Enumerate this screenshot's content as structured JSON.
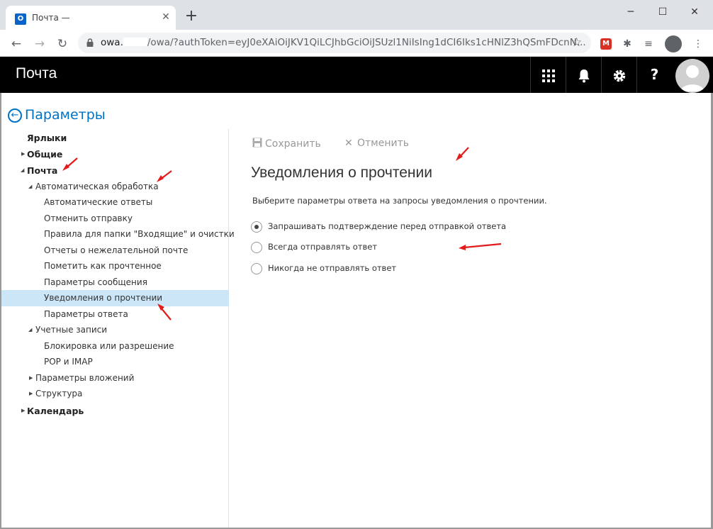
{
  "browser": {
    "tab_title": "Почта —",
    "tab_favicon_letter": "O",
    "url_host": "owa.",
    "url_rest": "/owa/?authToken=eyJ0eXAiOiJKV1QiLCJhbGciOiJSUzl1NiIsIng1dCI6Iks1cHNlZ3hQSmFDcnN..."
  },
  "appbar": {
    "title": "Почта",
    "help_glyph": "?"
  },
  "settings": {
    "back_label": "Параметры"
  },
  "sidebar": {
    "items": [
      {
        "label": "Ярлыки"
      },
      {
        "label": "Общие"
      },
      {
        "label": "Почта"
      },
      {
        "label": "Автоматическая обработка"
      },
      {
        "label": "Автоматические ответы"
      },
      {
        "label": "Отменить отправку"
      },
      {
        "label": "Правила для папки \"Входящие\" и очистки"
      },
      {
        "label": "Отчеты о нежелательной почте"
      },
      {
        "label": "Пометить как прочтенное"
      },
      {
        "label": "Параметры сообщения"
      },
      {
        "label": "Уведомления о прочтении"
      },
      {
        "label": "Параметры ответа"
      },
      {
        "label": "Учетные записи"
      },
      {
        "label": "Блокировка или разрешение"
      },
      {
        "label": "POP и IMAP"
      },
      {
        "label": "Параметры вложений"
      },
      {
        "label": "Структура"
      },
      {
        "label": "Календарь"
      }
    ]
  },
  "content": {
    "save_label": "Сохранить",
    "cancel_label": "Отменить",
    "heading": "Уведомления о прочтении",
    "description": "Выберите параметры ответа на запросы уведомления о прочтении.",
    "options": [
      {
        "label": "Запрашивать подтверждение перед отправкой ответа",
        "checked": true
      },
      {
        "label": "Всегда отправлять ответ",
        "checked": false
      },
      {
        "label": "Никогда не отправлять ответ",
        "checked": false
      }
    ]
  },
  "colors": {
    "accent": "#0072c6",
    "appbar": "#000000",
    "selected_row": "#cde6f7",
    "annotation_arrow": "#e31b1b"
  }
}
